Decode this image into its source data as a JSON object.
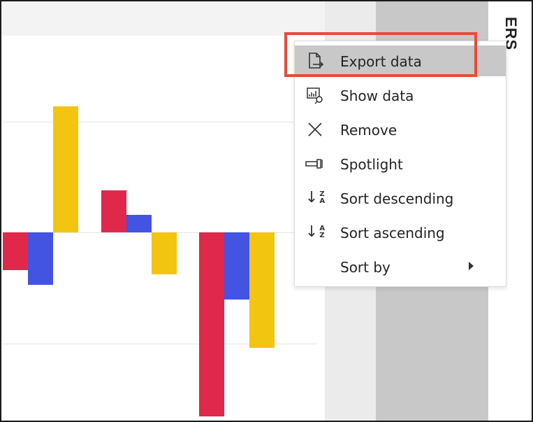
{
  "header": {
    "pane_label": "ERS"
  },
  "chart_data": {
    "type": "bar",
    "ylim": [
      -1.75,
      1.2
    ],
    "series": [
      {
        "color": "#e0284b",
        "values": [
          null,
          -0.36,
          0.4,
          -1.75
        ]
      },
      {
        "color": "#4353e2",
        "values": [
          null,
          -0.5,
          0.17,
          -0.64
        ]
      },
      {
        "color": "#f2c511",
        "values": [
          1.2,
          null,
          -0.4,
          -1.1
        ]
      }
    ]
  },
  "context_menu": {
    "items": [
      {
        "label": "Export data",
        "icon": "export-icon"
      },
      {
        "label": "Show data",
        "icon": "show-data-icon"
      },
      {
        "label": "Remove",
        "icon": "close-icon"
      },
      {
        "label": "Spotlight",
        "icon": "spotlight-icon"
      },
      {
        "label": "Sort descending",
        "icon": "sort-descending-icon"
      },
      {
        "label": "Sort ascending",
        "icon": "sort-ascending-icon"
      },
      {
        "label": "Sort by",
        "icon": ""
      }
    ],
    "highlight_color": "#e74c3c"
  }
}
